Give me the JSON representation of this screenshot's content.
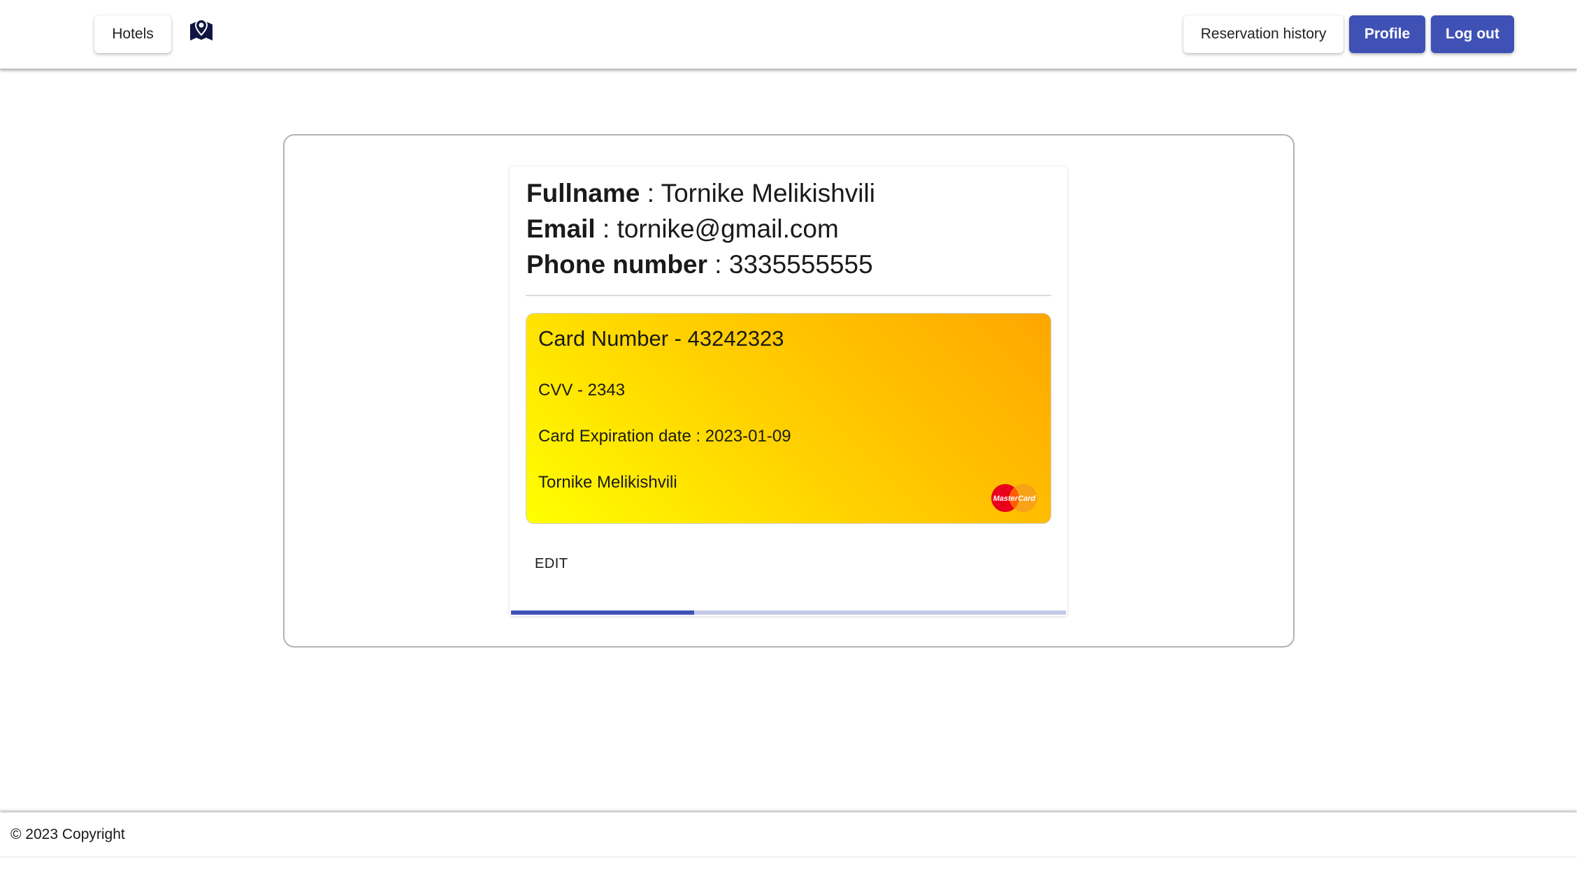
{
  "nav": {
    "hotels_label": "Hotels",
    "map_icon": "map-marker-icon",
    "reservation_history_label": "Reservation history",
    "profile_label": "Profile",
    "logout_label": "Log out"
  },
  "profile": {
    "fullname_label": "Fullname",
    "fullname_value": "Tornike Melikishvili",
    "email_label": "Email",
    "email_value": "tornike@gmail.com",
    "phone_label": "Phone number",
    "phone_value": "3335555555",
    "separator": " : "
  },
  "card": {
    "number_text": "Card Number - 43242323",
    "cvv_text": "CVV - 2343",
    "expiration_text": "Card Expiration date : 2023-01-09",
    "holder_name": "Tornike Melikishvili",
    "brand_logo": "MasterCard",
    "gradient_colors": [
      "#ffff00",
      "#ffd200",
      "#ffa600"
    ]
  },
  "actions": {
    "edit_label": "EDIT"
  },
  "progress": {
    "fraction": 0.33
  },
  "footer": {
    "copyright": "© 2023 Copyright"
  },
  "colors": {
    "primary": "#3f51b5",
    "progress_track": "#c5cae9"
  }
}
